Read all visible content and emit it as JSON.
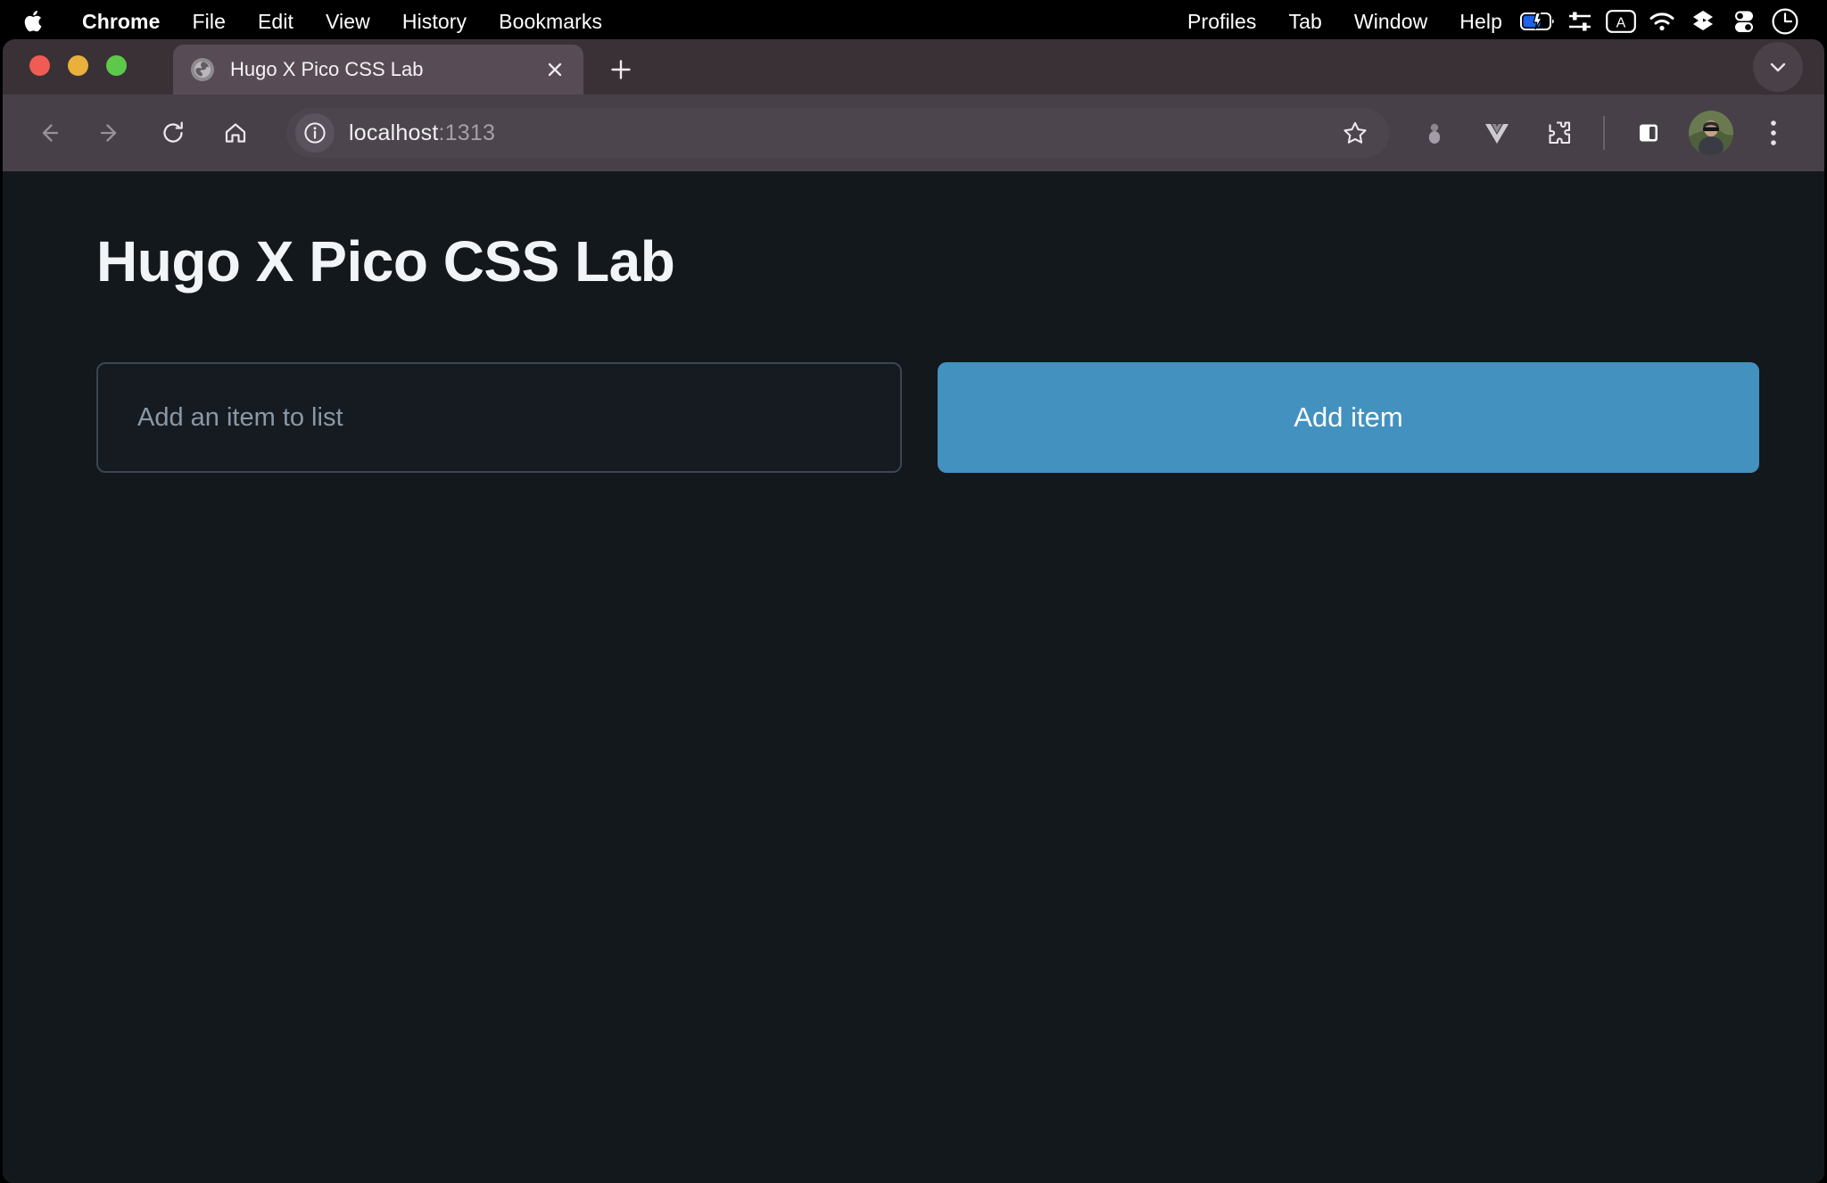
{
  "macos_menubar": {
    "apple_icon": "apple-logo-icon",
    "items": [
      {
        "label": "Chrome",
        "bold": true
      },
      {
        "label": "File",
        "bold": false
      },
      {
        "label": "Edit",
        "bold": false
      },
      {
        "label": "View",
        "bold": false
      },
      {
        "label": "History",
        "bold": false
      },
      {
        "label": "Bookmarks",
        "bold": false
      },
      {
        "label": "Profiles",
        "bold": false
      },
      {
        "label": "Tab",
        "bold": false
      },
      {
        "label": "Window",
        "bold": false
      },
      {
        "label": "Help",
        "bold": false
      }
    ],
    "status_icons": [
      "battery-charging-icon",
      "sliders-icon",
      "input-source-a-icon",
      "wifi-icon",
      "dropbox-icon",
      "control-center-icon",
      "clock-icon"
    ]
  },
  "browser": {
    "window_controls": [
      "close",
      "minimize",
      "zoom"
    ],
    "tab": {
      "title": "Hugo X Pico CSS Lab",
      "favicon": "globe-icon",
      "close_label": "×"
    },
    "new_tab_label": "+",
    "tab_list_chevron": "chevron-down-icon",
    "toolbar": {
      "back": "back-arrow-icon",
      "forward": "forward-arrow-icon",
      "reload": "reload-icon",
      "home": "home-icon",
      "site_info": "info-circle-icon",
      "url_host": "localhost",
      "url_port": ":1313",
      "bookmark": "star-icon",
      "extensions": [
        "password-extension-icon",
        "vue-devtools-icon",
        "puzzle-extension-icon"
      ],
      "side_panel": "side-panel-icon",
      "profile": "avatar-photo",
      "menu": "three-dot-menu-icon"
    }
  },
  "page": {
    "heading": "Hugo X Pico CSS Lab",
    "input_placeholder": "Add an item to list",
    "input_value": "",
    "add_button_label": "Add item",
    "colors": {
      "background": "#13181d",
      "accent": "#4391bf",
      "text": "#f2f5f8",
      "muted_text": "#8c98a4",
      "input_border": "#3b4652"
    }
  }
}
